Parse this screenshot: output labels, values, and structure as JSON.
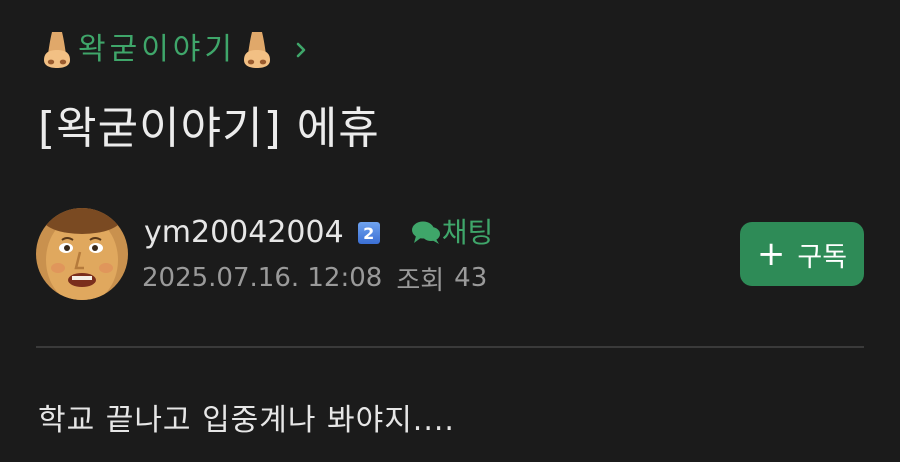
{
  "board": {
    "name": "왁굳이야기",
    "left_emoji": "nose-emoji",
    "right_emoji": "nose-emoji",
    "chevron_icon": "chevron-right-icon",
    "accent_color": "#3fa66a"
  },
  "post": {
    "title": "[왁굳이야기] 에휴",
    "body": "학교 끝나고 입중계나 봐야지...."
  },
  "author": {
    "username": "ym20042004",
    "level": "2",
    "avatar_icon": "avatar-face",
    "chat_icon": "chat-bubble-icon",
    "chat_label": "채팅",
    "date": "2025.07.16. 12:08",
    "views_label": "조회",
    "views_count": "43"
  },
  "subscribe": {
    "icon": "plus-icon",
    "plus_symbol": "+",
    "label": "구독",
    "color": "#2e8b57"
  },
  "colors": {
    "background": "#1b1b1b",
    "text": "#e8e8e8",
    "muted": "#9a9a9a",
    "divider": "#3a3a3a"
  }
}
